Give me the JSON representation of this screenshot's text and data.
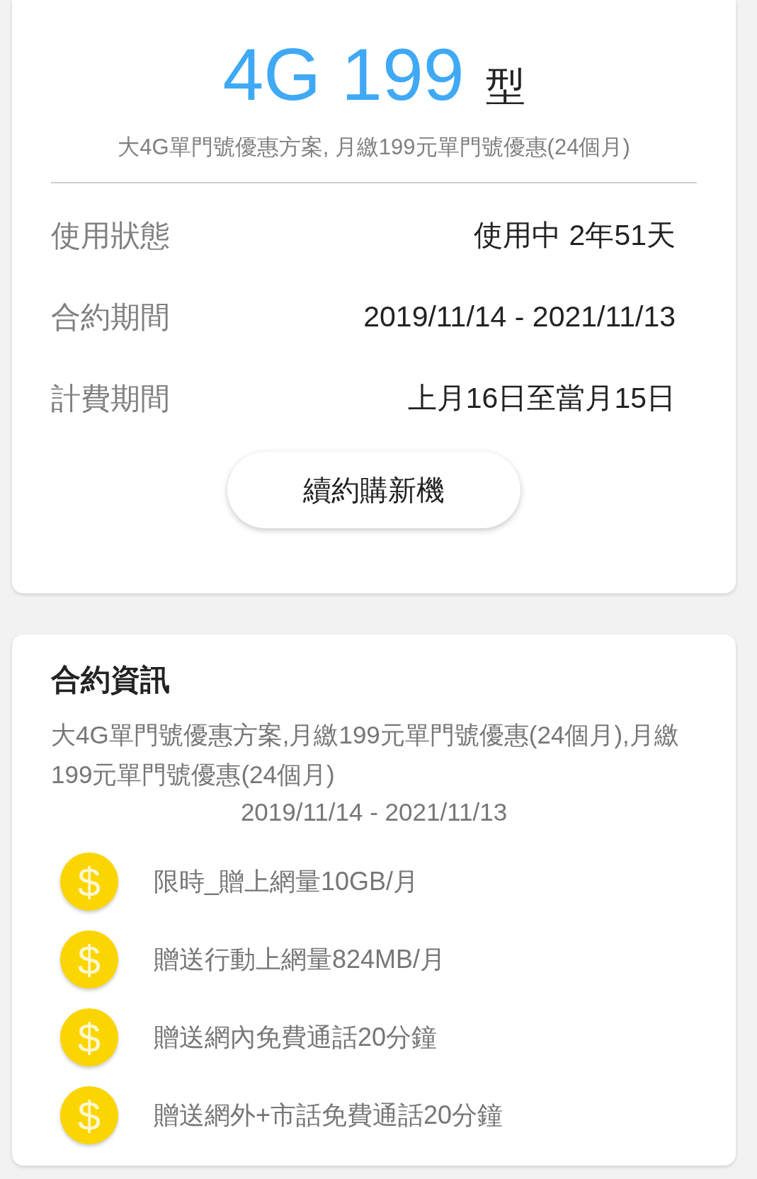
{
  "plan_card": {
    "title": "4G 199",
    "title_suffix": "型",
    "subtitle": "大4G單門號優惠方案, 月繳199元單門號優惠(24個月)",
    "rows": [
      {
        "label": "使用狀態",
        "value": "使用中 2年51天"
      },
      {
        "label": "合約期間",
        "value": "2019/11/14 - 2021/11/13"
      },
      {
        "label": "計費期間",
        "value": "上月16日至當月15日"
      }
    ],
    "button": "續約購新機"
  },
  "contract_card": {
    "heading": "合約資訊",
    "description": "大4G單門號優惠方案,月繳199元單門號優惠(24個月),月繳199元單門號優惠(24個月)",
    "period": "2019/11/14 - 2021/11/13",
    "benefits": [
      {
        "icon": "$",
        "text": "限時_贈上網量10GB/月"
      },
      {
        "icon": "$",
        "text": "贈送行動上網量824MB/月"
      },
      {
        "icon": "$",
        "text": "贈送網內免費通話20分鐘"
      },
      {
        "icon": "$",
        "text": "贈送網外+市話免費通話20分鐘"
      }
    ]
  }
}
